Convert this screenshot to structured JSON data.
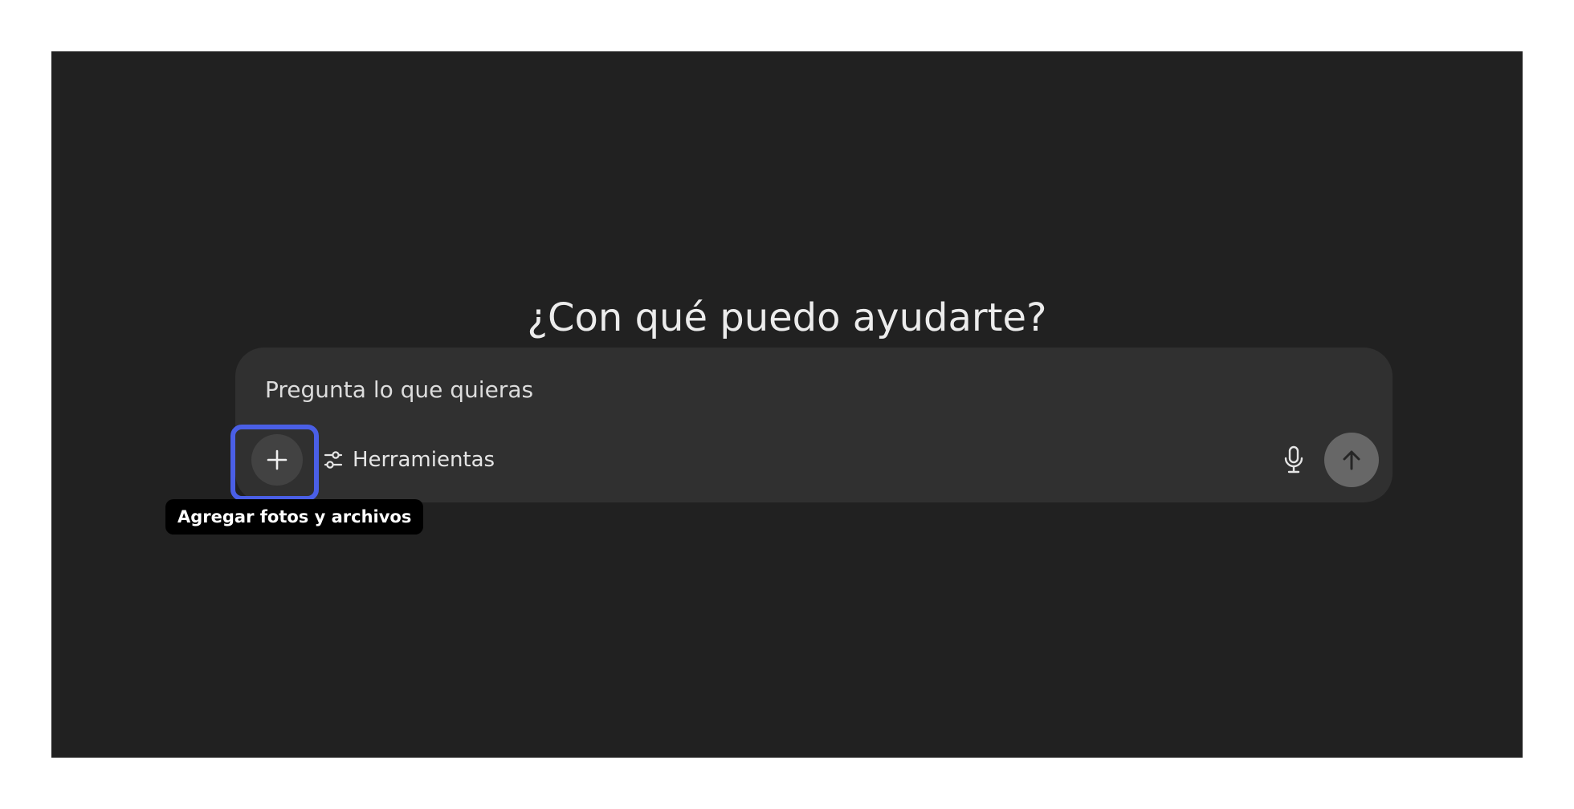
{
  "main": {
    "heading": "¿Con qué puedo ayudarte?"
  },
  "composer": {
    "placeholder": "Pregunta lo que quieras",
    "add_icon": "plus-icon",
    "tools_icon": "sliders-icon",
    "tools_label": "Herramientas",
    "mic_icon": "microphone-icon",
    "send_icon": "arrow-up-icon"
  },
  "tooltip": {
    "text": "Agregar fotos y archivos"
  },
  "colors": {
    "background": "#212121",
    "composer": "#303030",
    "highlight": "#4a5fe6",
    "send_button": "#676767"
  }
}
